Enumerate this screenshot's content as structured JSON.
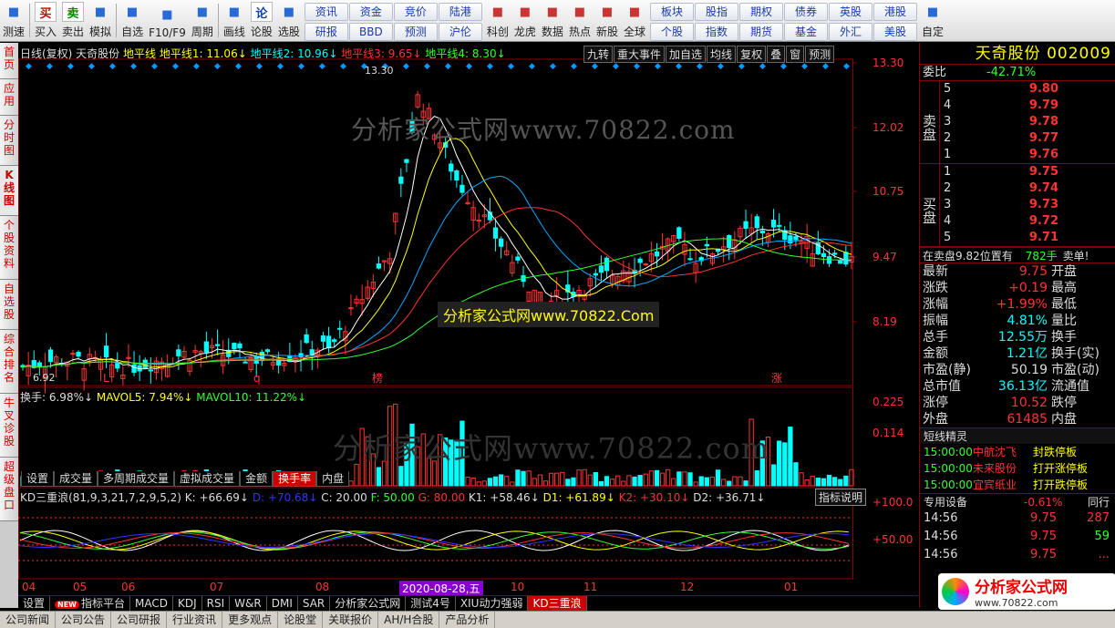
{
  "toolbar": {
    "left": [
      {
        "label": "测速",
        "icon": "speed-icon"
      },
      {
        "label": "买入",
        "icon": "buy-icon",
        "glyph": "买"
      },
      {
        "label": "卖出",
        "icon": "sell-icon",
        "glyph": "卖"
      },
      {
        "label": "模拟",
        "icon": "hammer-icon"
      },
      {
        "label": "自选",
        "icon": "star-icon"
      },
      {
        "label": "F10/F9",
        "icon": "f10-icon"
      },
      {
        "label": "周期",
        "icon": "clock-icon"
      },
      {
        "label": "画线",
        "icon": "pen-icon"
      },
      {
        "label": "论股",
        "icon": "forum-icon",
        "glyph": "论"
      },
      {
        "label": "选股",
        "icon": "magnifier-icon"
      }
    ],
    "grid_a": [
      "资讯",
      "资金",
      "竞价",
      "陆港",
      "研报",
      "BBD",
      "预测",
      "沪伦"
    ],
    "mid": [
      {
        "label": "科创",
        "icon": "chart-icon"
      },
      {
        "label": "龙虎",
        "icon": "dragon-icon"
      },
      {
        "label": "数据",
        "icon": "pe-icon"
      },
      {
        "label": "热点",
        "icon": "fire-icon"
      },
      {
        "label": "新股",
        "icon": "ipo-icon"
      },
      {
        "label": "全球",
        "icon": "globe-icon"
      }
    ],
    "grid_b": [
      "板块",
      "股指",
      "期权",
      "债券",
      "英股",
      "港股",
      "个股",
      "指数",
      "期货",
      "基金",
      "外汇",
      "美股"
    ],
    "right": [
      {
        "label": "自定",
        "icon": "custom-icon"
      }
    ]
  },
  "sidebar": [
    "首页",
    "应用",
    "分时图",
    "K线图",
    "个股资料",
    "自选股",
    "综合排名",
    "牛叉诊股",
    "超级盘口"
  ],
  "chart": {
    "title_prefix": "日线(复权) 天奇股份",
    "hline_label": "地平线",
    "hlines": [
      {
        "name": "地平线1:",
        "value": "11.06",
        "color": "#ff0"
      },
      {
        "name": "地平线2:",
        "value": "10.96",
        "color": "#0ff"
      },
      {
        "name": "地平线3:",
        "value": "9.65",
        "color": "#f33"
      },
      {
        "name": "地平线4:",
        "value": "8.30",
        "color": "#3f3"
      }
    ],
    "buttons": [
      "九转",
      "重大事件",
      "加自选",
      "均线",
      "复权",
      "叠",
      "窗",
      "预测"
    ],
    "price_axis": [
      "13.30",
      "12.02",
      "10.75",
      "9.47",
      "8.19"
    ],
    "high_label": "13.30",
    "low_label": "6.92",
    "markers": [
      "L",
      "q",
      "榜",
      "涨"
    ],
    "vol_header": [
      {
        "t": "换手: 6.98%↓",
        "c": "#ddd"
      },
      {
        "t": "MAVOL5: 7.94%↓",
        "c": "#ff0"
      },
      {
        "t": "MAVOL10: 11.22%↓",
        "c": "#3f3"
      }
    ],
    "vol_axis": [
      "0.225",
      "0.114"
    ],
    "vol_tabs": [
      "设置",
      "成交量",
      "多周期成交量",
      "虚拟成交量",
      "金额",
      "换手率",
      "内盘"
    ],
    "vol_active": "换手率",
    "kd_header": [
      {
        "t": "KD三重浪(81,9,3,21,7,2,9,5,2)",
        "c": "#ddd"
      },
      {
        "t": "K: +66.69↓",
        "c": "#ddd"
      },
      {
        "t": "D: +70.68↓",
        "c": "#33f"
      },
      {
        "t": "C: 20.00",
        "c": "#ddd"
      },
      {
        "t": "F: 50.00",
        "c": "#3f3"
      },
      {
        "t": "G: 80.00",
        "c": "#f33"
      },
      {
        "t": "K1: +58.46↓",
        "c": "#ddd"
      },
      {
        "t": "D1: +61.89↓",
        "c": "#ff0"
      },
      {
        "t": "K2: +30.10↓",
        "c": "#f33"
      },
      {
        "t": "D2: +36.71↓",
        "c": "#ddd"
      }
    ],
    "kd_button": "指标说明",
    "kd_axis": [
      "+100.0",
      "+50.00"
    ],
    "months": [
      "04",
      "05",
      "06",
      "07",
      "08",
      "10",
      "11",
      "12",
      "01"
    ],
    "date_highlight": "2020-08-28,五",
    "watermark1": "分析家公式网www.70822.com",
    "watermark2": "分析家公式网www.70822.Com"
  },
  "bottombar": {
    "items": [
      "设置",
      "指标平台",
      "MACD",
      "KDJ",
      "RSI",
      "W&R",
      "DMI",
      "SAR",
      "分析家公式网",
      "测试4号",
      "XIU动力强弱",
      "KD三重浪"
    ],
    "active": "KD三重浪",
    "new_badge": "NEW"
  },
  "statusbar": [
    "公司新闻",
    "公司公告",
    "公司研报",
    "行业资讯",
    "更多观点",
    "论股堂",
    "关联报价",
    "AH/H合股",
    "产品分析"
  ],
  "quote": {
    "name": "天奇股份",
    "code": "002009",
    "wei_label": "委比",
    "wei_value": "-42.71%",
    "sell_label": "卖盘",
    "buy_label": "买盘",
    "sell": [
      {
        "n": "5",
        "p": "9.80"
      },
      {
        "n": "4",
        "p": "9.79"
      },
      {
        "n": "3",
        "p": "9.78"
      },
      {
        "n": "2",
        "p": "9.77"
      },
      {
        "n": "1",
        "p": "9.76"
      }
    ],
    "buy": [
      {
        "n": "1",
        "p": "9.75"
      },
      {
        "n": "2",
        "p": "9.74"
      },
      {
        "n": "3",
        "p": "9.73"
      },
      {
        "n": "4",
        "p": "9.72"
      },
      {
        "n": "5",
        "p": "9.71"
      }
    ],
    "note": "在卖盘9.82位置有",
    "note_qty": "782手",
    "note_tail": "卖单!",
    "stats": [
      {
        "l": "最新",
        "v": "9.75",
        "c": "red",
        "r": "开盘"
      },
      {
        "l": "涨跌",
        "v": "+0.19",
        "c": "red",
        "r": "最高"
      },
      {
        "l": "涨幅",
        "v": "+1.99%",
        "c": "red",
        "r": "最低"
      },
      {
        "l": "振幅",
        "v": "4.81%",
        "c": "cyan",
        "r": "量比"
      },
      {
        "l": "总手",
        "v": "12.55万",
        "c": "cyan",
        "r": "换手"
      },
      {
        "l": "金额",
        "v": "1.21亿",
        "c": "cyan",
        "r": "换手(实)"
      },
      {
        "l": "市盈(静)",
        "v": "50.19",
        "c": "wht",
        "r": "市盈(动)"
      },
      {
        "l": "总市值",
        "v": "36.13亿",
        "c": "cyan",
        "r": "流通值"
      },
      {
        "l": "涨停",
        "v": "10.52",
        "c": "red",
        "r": "跌停"
      },
      {
        "l": "外盘",
        "v": "61485",
        "c": "red",
        "r": "内盘"
      }
    ],
    "elf_title": "短线精灵",
    "elf": [
      {
        "t": "15:00:00",
        "s": "中航沈飞",
        "e": "封跌停板"
      },
      {
        "t": "15:00:00",
        "s": "未来股份",
        "e": "打开涨停板"
      },
      {
        "t": "15:00:00",
        "s": "宜宾纸业",
        "e": "打开跌停板"
      }
    ],
    "device_label": "专用设备",
    "device_pct": "-0.61%",
    "device_tail": "同行",
    "ticks": [
      {
        "t": "14:56",
        "p": "9.75",
        "q": "287",
        "c": "red"
      },
      {
        "t": "14:56",
        "p": "9.75",
        "q": "59",
        "c": "grn"
      },
      {
        "t": "14:56",
        "p": "9.75",
        "q": "...",
        "c": "red"
      }
    ],
    "logo_text": "分析家公式网",
    "logo_url": "www.70822.com"
  }
}
